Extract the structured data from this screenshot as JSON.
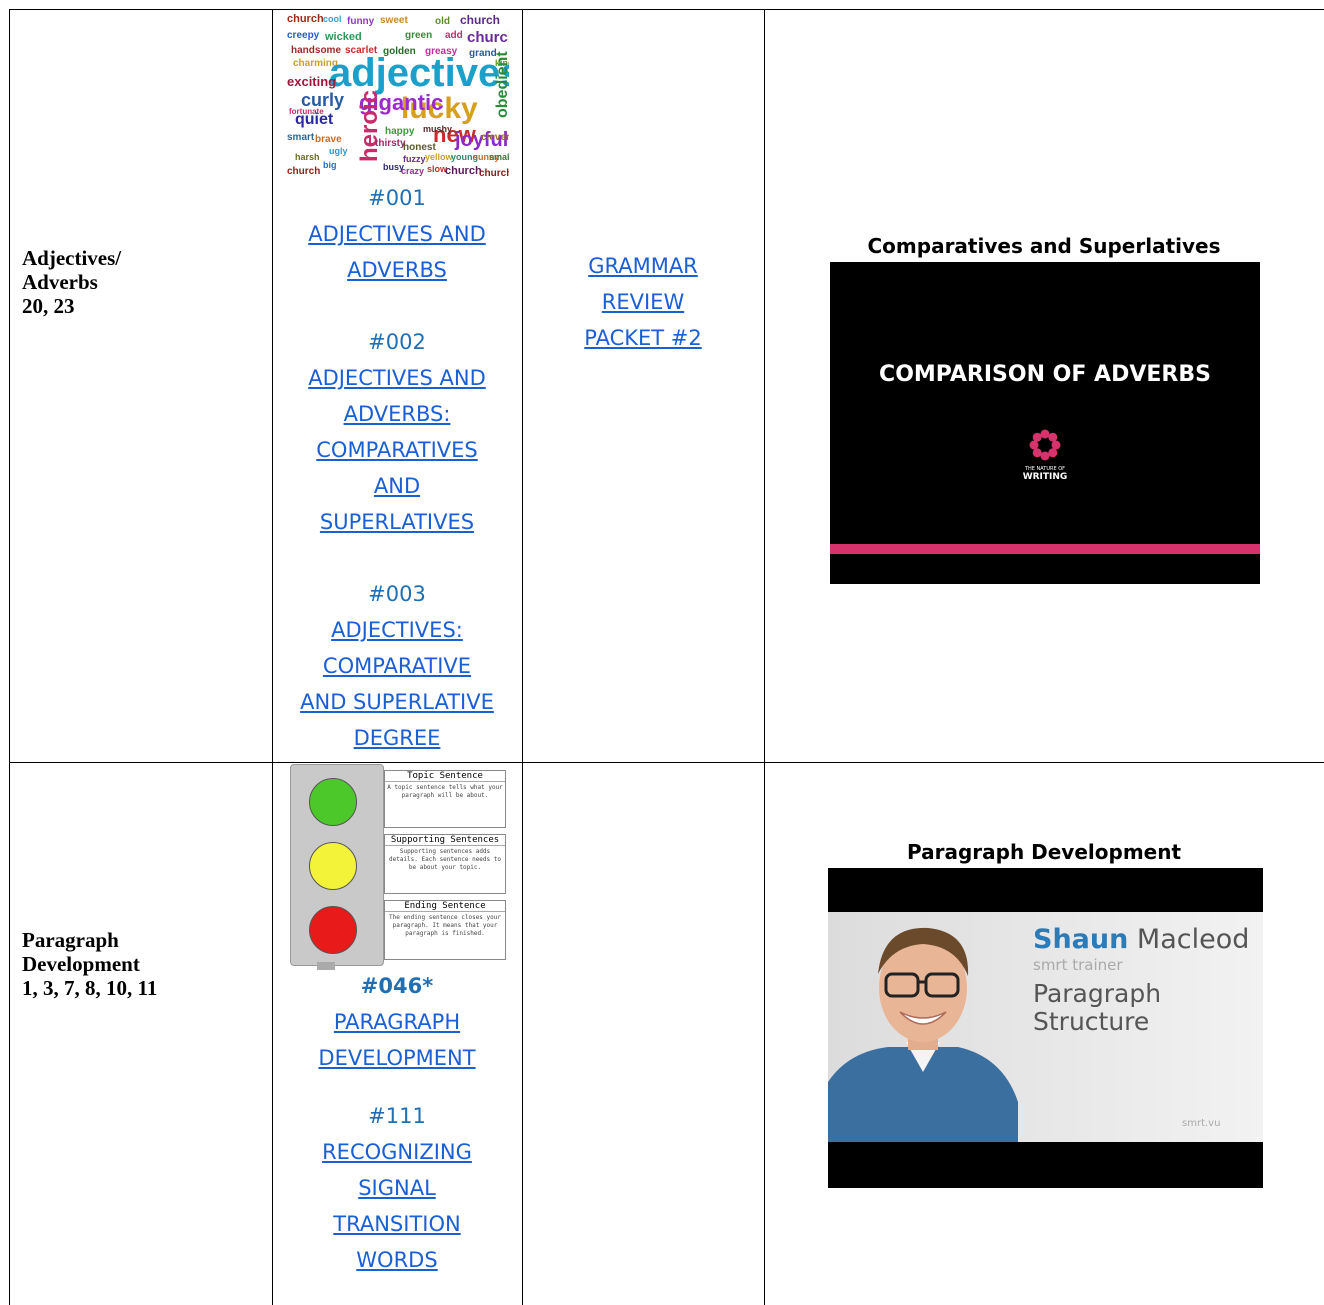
{
  "rows": [
    {
      "topic": [
        "Adjectives/",
        "Adverbs",
        "20, 23"
      ],
      "wordcloud": {
        "words": [
          "church",
          "cool",
          "funny",
          "sweet",
          "old",
          "church",
          "creepy",
          "wicked",
          "green",
          "add",
          "church",
          "handsome",
          "scarlet",
          "golden",
          "greasy",
          "grand",
          "kind",
          "charming",
          "adjectives",
          "exciting",
          "lucky",
          "curly",
          "gigantic",
          "obedient",
          "heroic",
          "quiet",
          "new",
          "joyful",
          "clever",
          "smart",
          "brave",
          "happy",
          "ugly",
          "thirsty",
          "honest",
          "fuzzy",
          "yellow",
          "young",
          "slow",
          "busy",
          "crazy",
          "sunny",
          "small",
          "harsh",
          "big",
          "church",
          "church",
          "church",
          "fortunate",
          "mushy"
        ]
      },
      "links": [
        {
          "num": "#001",
          "text": [
            "ADJECTIVES AND",
            "ADVERBS"
          ]
        },
        {
          "num": "#002",
          "text": [
            "ADJECTIVES AND",
            "ADVERBS:",
            "COMPARATIVES",
            "AND",
            "SUPERLATIVES"
          ]
        },
        {
          "num": "#003",
          "text": [
            "ADJECTIVES:",
            "COMPARATIVE",
            "AND SUPERLATIVE",
            "DEGREE"
          ]
        }
      ],
      "packet": [
        "GRAMMAR",
        "REVIEW",
        "PACKET #2"
      ],
      "video": {
        "title": "Comparatives and Superlatives",
        "thumb_text": "COMPARISON OF ADVERBS",
        "logo_small": "THE NATURE OF",
        "logo_big": "WRITING"
      }
    },
    {
      "topic": [
        "Paragraph",
        "Development",
        "1, 3, 7, 8, 10, 11"
      ],
      "trafficlight": [
        {
          "title": "Topic Sentence",
          "desc": "A topic sentence tells what your paragraph will be about."
        },
        {
          "title": "Supporting Sentences",
          "desc": "Supporting sentences adds details. Each sentence needs to be about your topic."
        },
        {
          "title": "Ending Sentence",
          "desc": "The ending sentence closes your paragraph. It means that your paragraph is finished."
        }
      ],
      "links": [
        {
          "num": "#046*",
          "text": [
            "PARAGRAPH",
            "DEVELOPMENT"
          ]
        },
        {
          "num": "#111",
          "text": [
            "RECOGNIZING",
            "SIGNAL",
            "TRANSITION",
            "WORDS"
          ]
        }
      ],
      "video": {
        "title": "Paragraph Development",
        "name_first": "Shaun",
        "name_last": " Macleod",
        "role": "smrt trainer",
        "subject": [
          "Paragraph",
          "Structure"
        ],
        "brand": "smrt.vu"
      }
    }
  ],
  "colors": {
    "link": "#1a5fd6",
    "number": "#1f6fb5",
    "accent": "#d6336c",
    "shaun": "#2a7bb8"
  }
}
